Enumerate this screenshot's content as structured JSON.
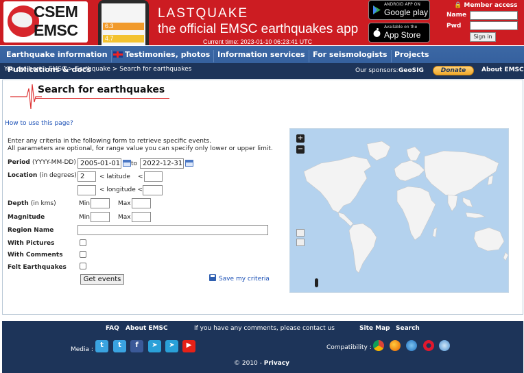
{
  "header": {
    "logo_line1": "CSEM",
    "logo_line2": "EMSC",
    "phone_values": [
      "6.3",
      "4.7"
    ],
    "brand_title": "LASTQUAKE",
    "brand_subtitle": "the official EMSC earthquakes app",
    "current_time": "Current time: 2023-01-10 06:23:41 UTC",
    "google_play_small": "ANDROID APP ON",
    "google_play_big": "Google play",
    "app_store_small": "Available on the",
    "app_store_big": "App Store",
    "member_access": "Member access",
    "name_label": "Name",
    "pwd_label": "Pwd",
    "sign_in": "Sign in"
  },
  "nav": {
    "items": [
      "Earthquake information",
      "Testimonies, photos",
      "Information services",
      "For seismologists",
      "Projects"
    ],
    "publications": "Publications & docs",
    "breadcrumb": "You are here : EMSC > Earthquake > Search for earthquakes",
    "sponsors_label": "Our sponsors:",
    "sponsor_name": "GeoSIG",
    "donate": "Donate",
    "about": "About EMSC"
  },
  "main": {
    "title": "Search for earthquakes",
    "howto": "How to use this page?",
    "intro1": "Enter any criteria in the following form to retrieve specific events.",
    "intro2": "All parameters are optional, for range value you can specify only lower or upper limit.",
    "period_label": "Period",
    "period_hint": "(YYYY-MM-DD)",
    "period_from": "2005-01-01",
    "period_to_label": "to",
    "period_to": "2022-12-31",
    "location_label": "Location",
    "location_hint": "(in degrees)",
    "lat_min": "2",
    "latitude_label": "< latitude",
    "lat_lt": "<",
    "longitude_label": "< longitude <",
    "depth_label": "Depth",
    "depth_hint": "(in kms)",
    "magnitude_label": "Magnitude",
    "min_label": "Min",
    "max_label": "Max",
    "region_label": "Region Name",
    "pictures_label": "With Pictures",
    "comments_label": "With Comments",
    "felt_label": "Felt Earthquakes",
    "get_events": "Get events",
    "save_criteria": "Save my criteria",
    "zoom_in": "+",
    "zoom_out": "−"
  },
  "footer": {
    "faq": "FAQ",
    "about": "About EMSC",
    "comments": "If you have any comments, please contact us",
    "sitemap": "Site Map",
    "search": "Search",
    "media": "Media :",
    "compatibility": "Compatibility :",
    "copyright": "© 2010 -",
    "privacy": "Privacy"
  },
  "colors": {
    "banner_red": "#cc1c22",
    "nav_blue": "#3c68a5",
    "dark_navy": "#1d3459",
    "map_water": "#b4d2ee",
    "link_blue": "#1a4fb5"
  }
}
